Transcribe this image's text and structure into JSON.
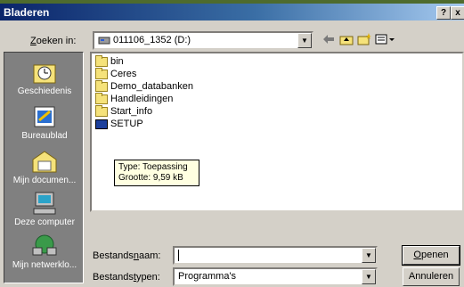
{
  "window": {
    "title": "Bladeren",
    "help_button": "?",
    "close_button": "x"
  },
  "lookin": {
    "label": "Zoeken in:",
    "value": "011106_1352 (D:)"
  },
  "toolbar": {
    "back_icon": "back-arrow-icon",
    "up_icon": "folder-up-icon",
    "new_folder_icon": "new-folder-icon",
    "view_menu_icon": "view-menu-icon"
  },
  "places": [
    {
      "label": "Geschiedenis",
      "icon": "history-icon"
    },
    {
      "label": "Bureaublad",
      "icon": "desktop-icon"
    },
    {
      "label": "Mijn documen...",
      "icon": "my-documents-icon"
    },
    {
      "label": "Deze computer",
      "icon": "my-computer-icon"
    },
    {
      "label": "Mijn netwerklo...",
      "icon": "network-places-icon"
    }
  ],
  "files": [
    {
      "name": "bin",
      "type": "folder"
    },
    {
      "name": "Ceres",
      "type": "folder"
    },
    {
      "name": "Demo_databanken",
      "type": "folder"
    },
    {
      "name": "Handleidingen",
      "type": "folder"
    },
    {
      "name": "Start_info",
      "type": "folder"
    },
    {
      "name": "SETUP",
      "type": "application"
    }
  ],
  "tooltip": {
    "line1": "Type: Toepassing",
    "line2": "Grootte: 9,59 kB"
  },
  "filename": {
    "label_pre": "Bestands",
    "label_ul": "n",
    "label_post": "aam:",
    "value": ""
  },
  "filetype": {
    "label_pre": "Bestands",
    "label_ul": "t",
    "label_post": "ypen:",
    "value": "Programma's"
  },
  "buttons": {
    "open_ul": "O",
    "open_rest": "penen",
    "cancel": "Annuleren"
  }
}
